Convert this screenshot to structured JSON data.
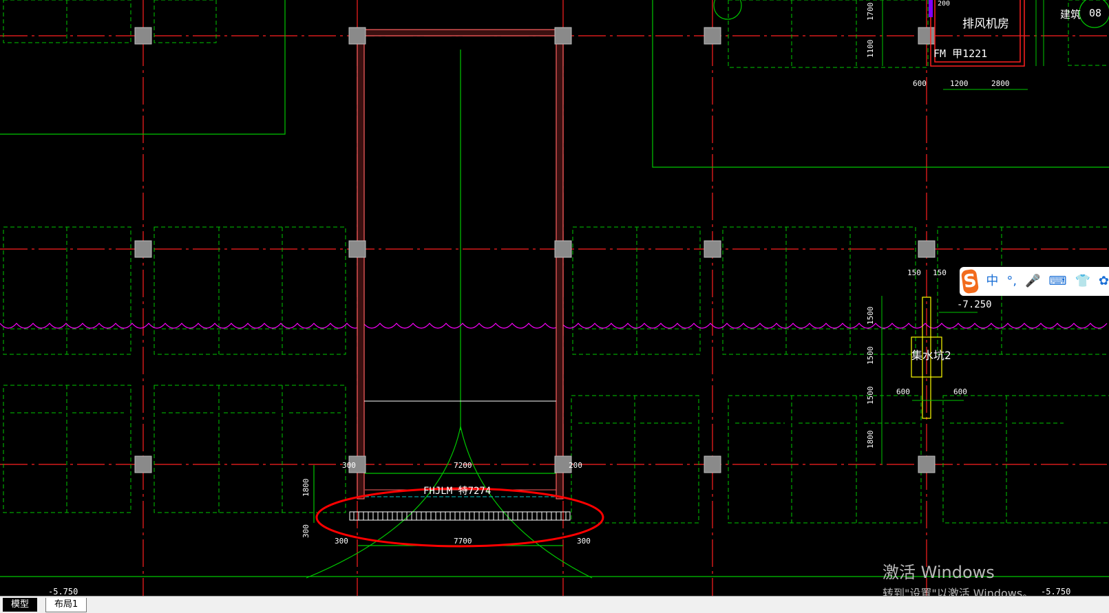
{
  "drawing": {
    "room_label": "排风机房",
    "door_label_top": "FM 甲1221",
    "dim_600_top": "600",
    "dim_1200_top": "1200",
    "dim_2800_top": "2800",
    "dim_1700_a": "1700",
    "dim_1100_a": "1100",
    "dim_200_top": "200",
    "label_08": "08",
    "label_jianzhu": "建筑",
    "dim_150_l": "150",
    "dim_150_r": "150",
    "elevation_pit": "-7.250",
    "sump_label": "集水坑2",
    "dim_1500_a": "1500",
    "dim_1500_b": "1500",
    "dim_1500_c": "1500",
    "dim_1800_r": "1800",
    "dim_600_l": "600",
    "dim_600_r": "600",
    "dim_300_left": "300",
    "dim_200_right": "200",
    "dim_7200": "7200",
    "door_label_bottom": "FHJLM  特7274",
    "dim_1800_left": "1800",
    "dim_300_vertical": "300",
    "dim_300_bottom_left": "300",
    "dim_7700": "7700",
    "dim_300_bottom_right": "300",
    "elevation_left": "-5.750",
    "elevation_right": "-5.750"
  },
  "colors": {
    "axis": "#ff2020",
    "green": "#00c800",
    "wall": "#ff6060",
    "magenta": "#ff00ff",
    "column": "#8a8a8a",
    "annotation_ellipse": "#ff0000",
    "yellow": "#ffff00"
  },
  "ime_toolbar": {
    "logo": "S",
    "mode": "中",
    "punct": "°,",
    "mic_icon": "🎤",
    "keyboard_icon": "⌨",
    "skin_icon": "👕",
    "apps_icon": "✿"
  },
  "watermark": {
    "line1": "激活 Windows",
    "line2": "转到\"设置\"以激活 Windows。"
  },
  "tabs": {
    "model": "模型",
    "layout1": "布局1"
  }
}
